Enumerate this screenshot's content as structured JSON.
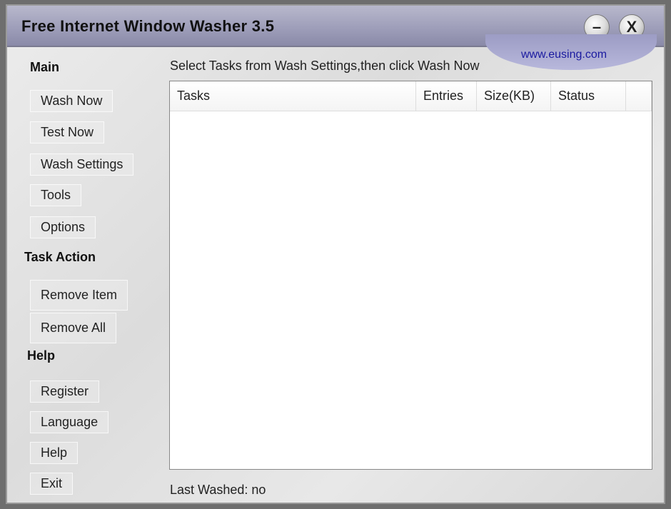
{
  "window": {
    "title": "Free Internet Window Washer 3.5",
    "minimize_label": "–",
    "close_label": "X",
    "url": "www.eusing.com"
  },
  "sidebar": {
    "main_heading": "Main",
    "main_items": [
      "Wash Now",
      "Test Now",
      "Wash Settings",
      "Tools",
      "Options"
    ],
    "task_heading": "Task Action",
    "task_items": [
      "Remove Item",
      "Remove All"
    ],
    "help_heading": "Help",
    "help_items": [
      "Register",
      "Language",
      "Help",
      "Exit"
    ]
  },
  "main": {
    "hint": "Select Tasks from Wash Settings,then click Wash Now",
    "columns": [
      "Tasks",
      "Entries",
      "Size(KB)",
      "Status"
    ],
    "rows": [],
    "last_washed": "Last Washed: no"
  }
}
